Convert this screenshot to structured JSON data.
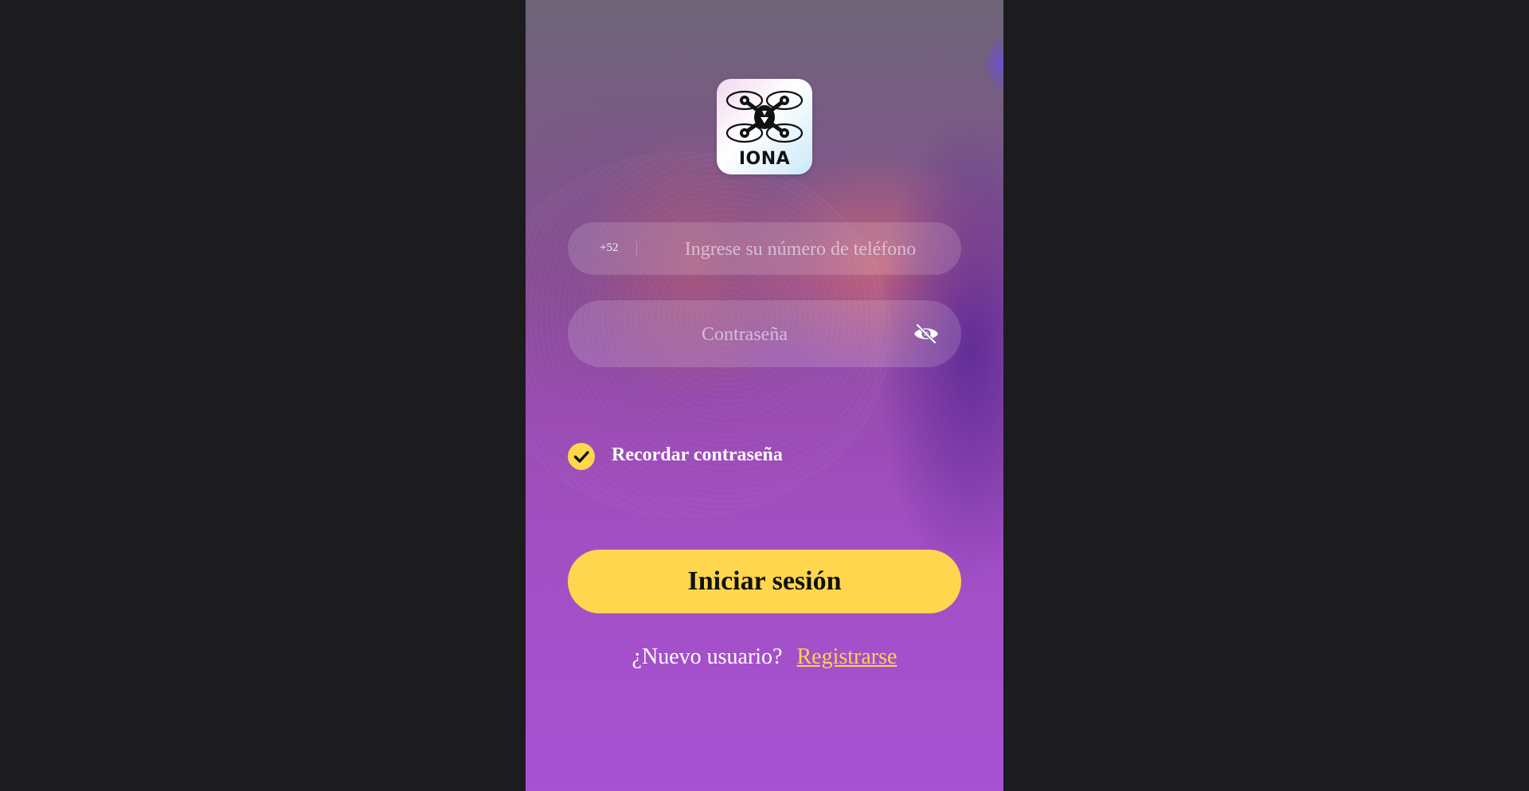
{
  "app": {
    "logo_text": "IONA"
  },
  "login": {
    "country_code": "+52",
    "phone_placeholder": "Ingrese su número de teléfono",
    "phone_value": "",
    "password_placeholder": "Contraseña",
    "password_value": "",
    "password_toggle_icon": "eye-off-icon",
    "remember_label": "Recordar contraseña",
    "remember_checked": true,
    "submit_label": "Iniciar sesión",
    "new_user_text": "¿Nuevo usuario?",
    "register_label": "Registrarse"
  },
  "colors": {
    "accent": "#ffd64d",
    "link": "#ffd24a",
    "page_background": "#1c1c1e"
  }
}
